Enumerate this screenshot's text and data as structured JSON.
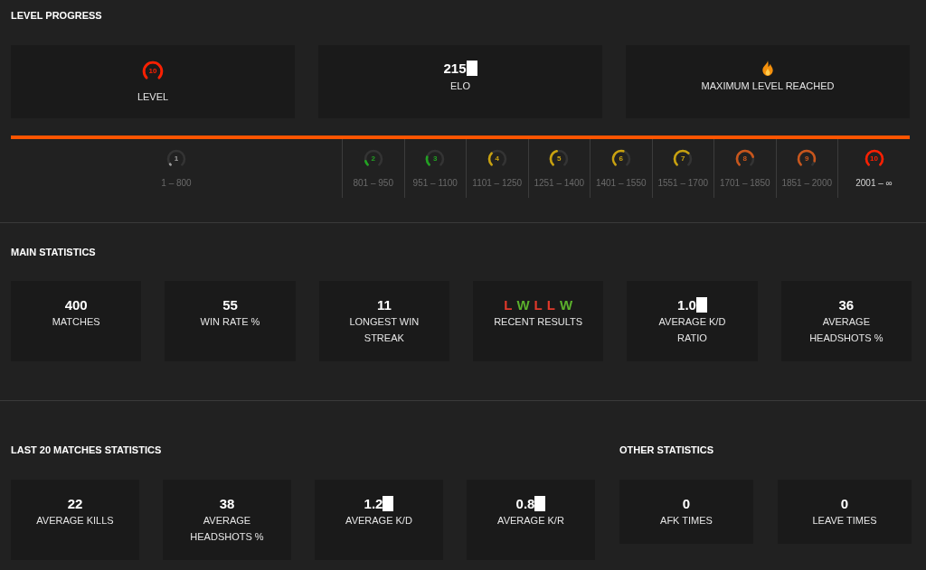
{
  "level_progress": {
    "title": "LEVEL PROGRESS",
    "cards": [
      {
        "kind": "level",
        "badge": "10",
        "label": "LEVEL"
      },
      {
        "kind": "value",
        "value": "215",
        "redacted": true,
        "label": "ELO"
      },
      {
        "kind": "fire",
        "label": "MAXIMUM LEVEL REACHED"
      }
    ],
    "progress": {
      "level": 1
    },
    "levels": [
      {
        "number": "1",
        "range": "1 – 800",
        "color": "#9e9e9e",
        "selected": false
      },
      {
        "number": "2",
        "range": "801 – 950",
        "color": "#22a322",
        "selected": false
      },
      {
        "number": "3",
        "range": "951 – 1100",
        "color": "#22a322",
        "selected": false
      },
      {
        "number": "4",
        "range": "1101 – 1250",
        "color": "#c9a20f",
        "selected": false
      },
      {
        "number": "5",
        "range": "1251 – 1400",
        "color": "#c9a20f",
        "selected": false
      },
      {
        "number": "6",
        "range": "1401 – 1550",
        "color": "#c9a20f",
        "selected": false
      },
      {
        "number": "7",
        "range": "1551 – 1700",
        "color": "#c9a20f",
        "selected": false
      },
      {
        "number": "8",
        "range": "1701 – 1850",
        "color": "#c8561c",
        "selected": false
      },
      {
        "number": "9",
        "range": "1851 – 2000",
        "color": "#c8561c",
        "selected": false
      },
      {
        "number": "10",
        "range": "2001 – ∞",
        "color": "#fe1f00",
        "selected": true
      }
    ]
  },
  "main_statistics": {
    "title": "MAIN STATISTICS",
    "cards": [
      {
        "kind": "value",
        "value": "400",
        "redacted": false,
        "label": "MATCHES"
      },
      {
        "kind": "value",
        "value": "55",
        "redacted": false,
        "label": "WIN RATE %"
      },
      {
        "kind": "value",
        "value": "11",
        "redacted": false,
        "label": "LONGEST WIN STREAK"
      },
      {
        "kind": "results",
        "results": [
          {
            "letter": "L",
            "color": "#e0392b"
          },
          {
            "letter": "W",
            "color": "#5bb02c"
          },
          {
            "letter": "L",
            "color": "#e0392b"
          },
          {
            "letter": "L",
            "color": "#e0392b"
          },
          {
            "letter": "W",
            "color": "#5bb02c"
          }
        ],
        "label": "RECENT RESULTS"
      },
      {
        "kind": "value",
        "value": "1.0",
        "redacted": true,
        "label": "AVERAGE K/D RATIO"
      },
      {
        "kind": "value",
        "value": "36",
        "redacted": false,
        "label": "AVERAGE HEADSHOTS %"
      }
    ]
  },
  "last_20_matches_statistics": {
    "title": "LAST 20 MATCHES STATISTICS",
    "cards": [
      {
        "kind": "value",
        "value": "22",
        "redacted": false,
        "label": "AVERAGE KILLS"
      },
      {
        "kind": "value",
        "value": "38",
        "redacted": false,
        "label": "AVERAGE HEADSHOTS %"
      },
      {
        "kind": "value",
        "value": "1.2",
        "redacted": true,
        "label": "AVERAGE K/D"
      },
      {
        "kind": "value",
        "value": "0.8",
        "redacted": true,
        "label": "AVERAGE K/R"
      }
    ]
  },
  "other_statistics": {
    "title": "OTHER STATISTICS",
    "cards": [
      {
        "kind": "value",
        "value": "0",
        "redacted": false,
        "label": "AFK TIMES"
      },
      {
        "kind": "value",
        "value": "0",
        "redacted": false,
        "label": "LEAVE TIMES"
      }
    ]
  }
}
